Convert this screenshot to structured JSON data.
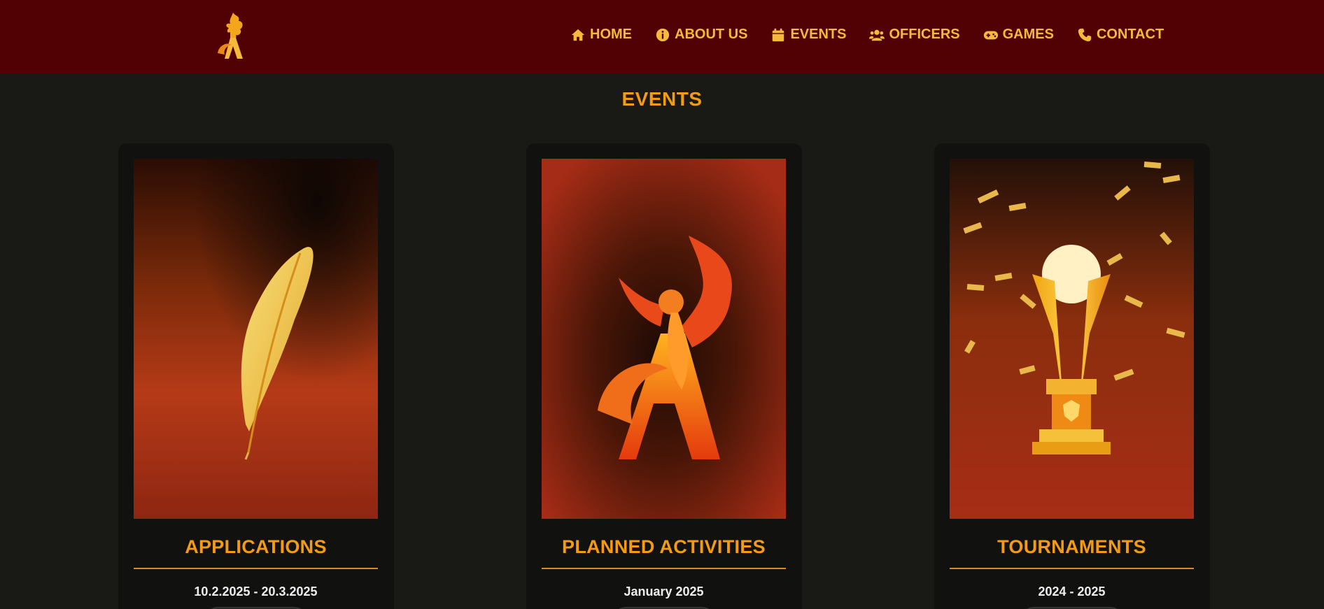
{
  "nav": {
    "items": [
      {
        "label": "HOME",
        "icon": "home-icon"
      },
      {
        "label": "ABOUT US",
        "icon": "info-icon"
      },
      {
        "label": "EVENTS",
        "icon": "calendar-icon"
      },
      {
        "label": "OFFICERS",
        "icon": "users-icon"
      },
      {
        "label": "GAMES",
        "icon": "gamepad-icon"
      },
      {
        "label": "CONTACT",
        "icon": "phone-icon"
      }
    ]
  },
  "page": {
    "title": "EVENTS"
  },
  "cards": [
    {
      "title": "APPLICATIONS",
      "date": "10.2.2025 - 20.3.2025",
      "image": "golden-feather-image"
    },
    {
      "title": "PLANNED ACTIVITIES",
      "date": "January 2025",
      "image": "phoenix-logo-image"
    },
    {
      "title": "TOURNAMENTS",
      "date": "2024 - 2025",
      "image": "trophy-image"
    }
  ],
  "colors": {
    "header_bg": "#510003",
    "page_bg": "#191a16",
    "accent": "#f49b12",
    "nav_text": "#f6b93b"
  }
}
